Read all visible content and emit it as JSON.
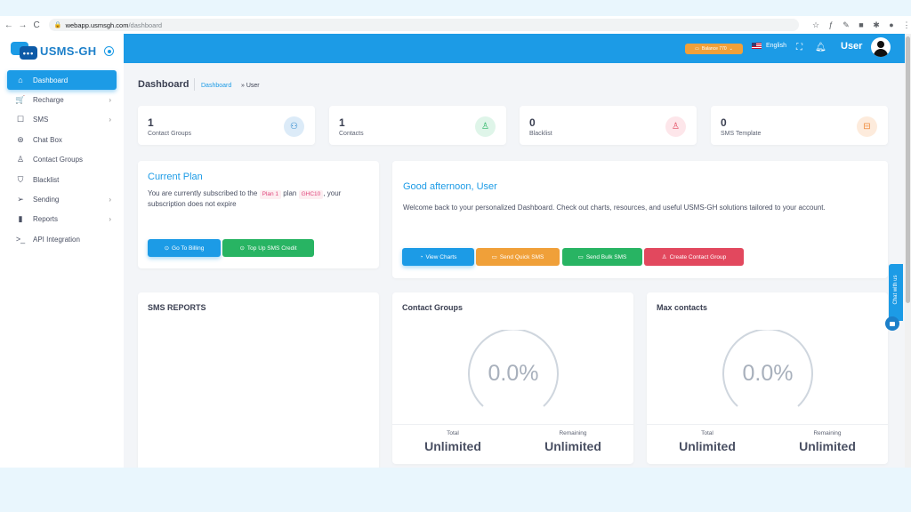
{
  "browser": {
    "url_host": "webapp.usmsgh.com",
    "url_path": "/dashboard"
  },
  "brand": {
    "logo_text": "USMS-GH",
    "logo_mark_text": "•••"
  },
  "sidebar": {
    "items": [
      {
        "label": "Dashboard",
        "icon": "home-icon",
        "glyph": "⌂",
        "active": true,
        "has_children": false
      },
      {
        "label": "Recharge",
        "icon": "cart-icon",
        "glyph": "🛒",
        "active": false,
        "has_children": true
      },
      {
        "label": "SMS",
        "icon": "message-icon",
        "glyph": "☐",
        "active": false,
        "has_children": true
      },
      {
        "label": "Chat Box",
        "icon": "chat-icon",
        "glyph": "⊛",
        "active": false,
        "has_children": false
      },
      {
        "label": "Contact Groups",
        "icon": "user-icon",
        "glyph": "♙",
        "active": false,
        "has_children": false
      },
      {
        "label": "Blacklist",
        "icon": "shield-icon",
        "glyph": "⛉",
        "active": false,
        "has_children": false
      },
      {
        "label": "Sending",
        "icon": "send-icon",
        "glyph": "➢",
        "active": false,
        "has_children": true
      },
      {
        "label": "Reports",
        "icon": "bar-chart-icon",
        "glyph": "▮",
        "active": false,
        "has_children": true
      },
      {
        "label": "API Integration",
        "icon": "terminal-icon",
        "glyph": ">_",
        "active": false,
        "has_children": false
      }
    ]
  },
  "topbar": {
    "balance_label": "Balance 770",
    "language": "English",
    "user": "User"
  },
  "breadcrumb": {
    "title": "Dashboard",
    "link": "Dashboard",
    "current": "» User"
  },
  "stats": [
    {
      "value": "1",
      "label": "Contact Groups",
      "icon": "users-icon",
      "bg": "#dcebf8",
      "fg": "#1c7fc9",
      "glyph": "⚇"
    },
    {
      "value": "1",
      "label": "Contacts",
      "icon": "user-icon",
      "bg": "#dff5e9",
      "fg": "#28b463",
      "glyph": "♙"
    },
    {
      "value": "0",
      "label": "Blacklist",
      "icon": "user-x-icon",
      "bg": "#fde6ea",
      "fg": "#e2485e",
      "glyph": "♙"
    },
    {
      "value": "0",
      "label": "SMS Template",
      "icon": "inbox-icon",
      "bg": "#fdebdc",
      "fg": "#ef8a3a",
      "glyph": "⊟"
    }
  ],
  "plan": {
    "title": "Current Plan",
    "text_before": "You are currently subscribed to the",
    "plan_name": "Plan 1",
    "text_mid": "plan",
    "price": "GHC10",
    "text_after": ", your subscription does not expire",
    "billing_button": "Go To Billing",
    "topup_button": "Top Up SMS Credit"
  },
  "welcome": {
    "greeting": "Good afternoon,",
    "user": "User",
    "message": "Welcome back to your personalized Dashboard. Check out charts, resources, and useful USMS-GH solutions tailored to your account.",
    "buttons": {
      "view_charts": "View Charts",
      "send_quick": "Send Quick SMS",
      "send_bulk": "Send Bulk SMS",
      "create_group": "Create Contact Group"
    }
  },
  "sms_reports": {
    "title": "SMS REPORTS"
  },
  "contact_groups_card": {
    "title": "Contact Groups",
    "percent": 0.0,
    "percent_label": "0.0%",
    "total_label": "Total",
    "total_value": "Unlimited",
    "remaining_label": "Remaining",
    "remaining_value": "Unlimited"
  },
  "max_contacts_card": {
    "title": "Max contacts",
    "percent": 0.0,
    "percent_label": "0.0%",
    "total_label": "Total",
    "total_value": "Unlimited",
    "remaining_label": "Remaining",
    "remaining_value": "Unlimited"
  },
  "chat_widget": {
    "label": "Chat with us"
  },
  "colors": {
    "primary": "#1c9be6",
    "orange": "#f0a039",
    "green": "#28b463",
    "red": "#e2485e"
  }
}
